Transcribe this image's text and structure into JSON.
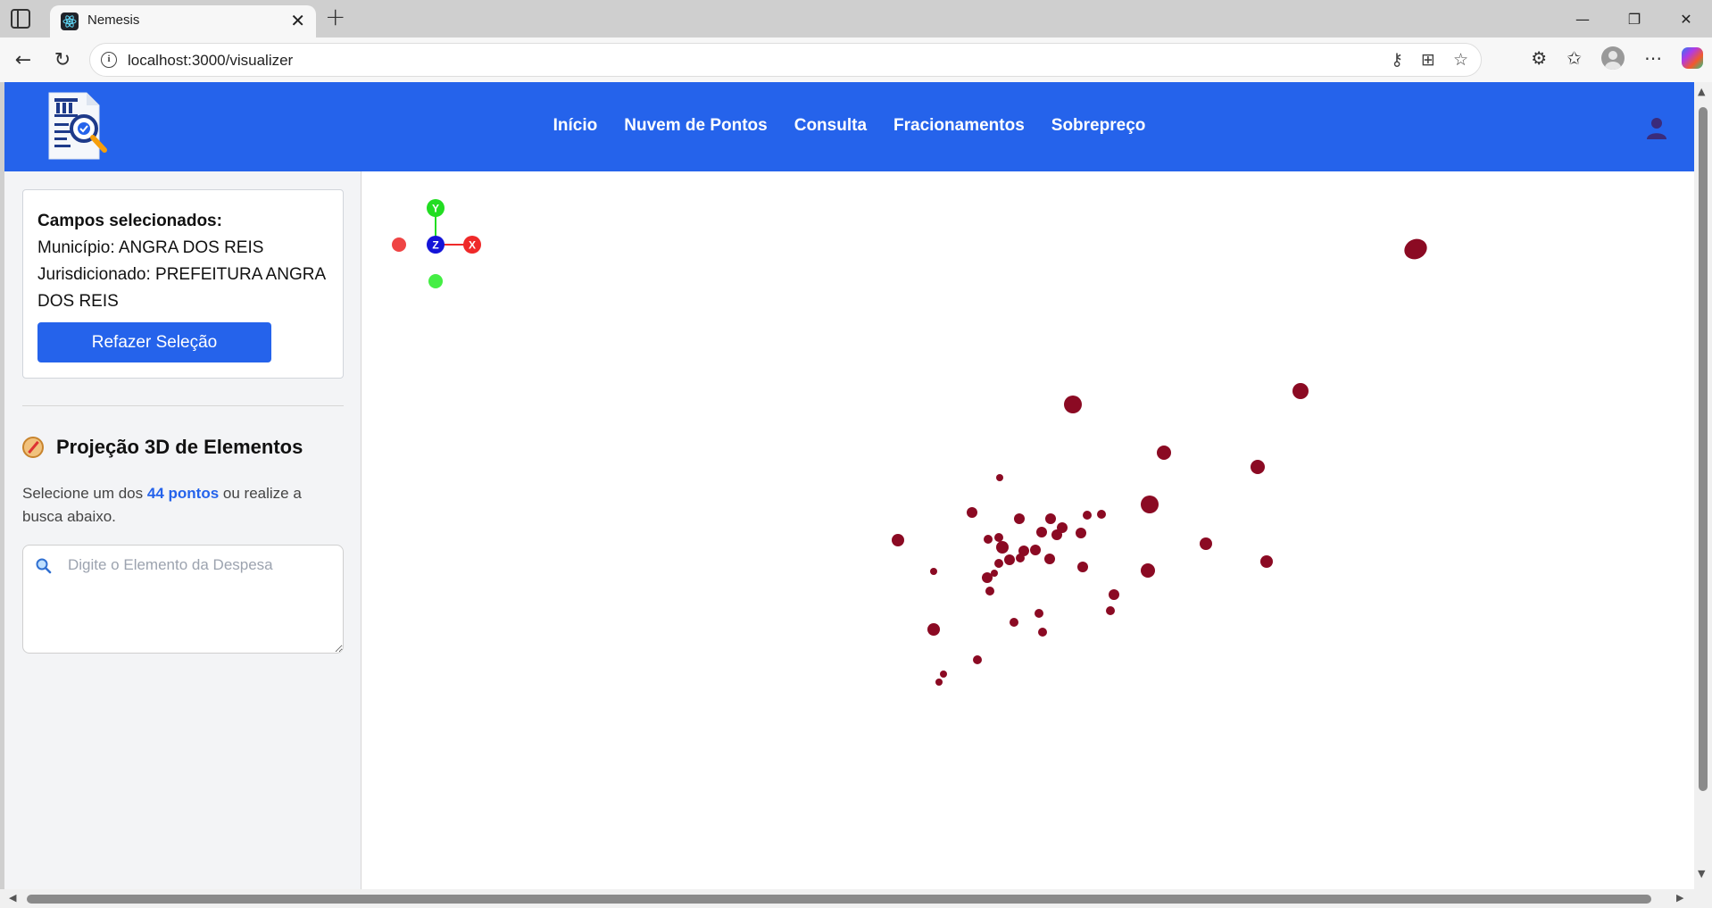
{
  "browser": {
    "tab_title": "Nemesis",
    "url": "localhost:3000/visualizer",
    "icons": [
      "sidebar-toggle-icon",
      "react-icon",
      "close-icon",
      "plus-icon",
      "back-icon",
      "reload-icon",
      "info-icon",
      "key-icon",
      "app-icon",
      "star-icon",
      "extensions-icon",
      "favorites-icon",
      "profile-icon",
      "more-icon",
      "copilot-icon"
    ]
  },
  "header": {
    "nav": [
      "Início",
      "Nuvem de Pontos",
      "Consulta",
      "Fracionamentos",
      "Sobrepreço"
    ],
    "accent": "#2563eb"
  },
  "sidebar": {
    "selection": {
      "heading": "Campos selecionados:",
      "municipio": "Município: ANGRA DOS REIS",
      "jurisdicionado": "Jurisdicionado: PREFEITURA ANGRA DOS REIS",
      "redo_button": "Refazer Seleção"
    },
    "projection": {
      "title": "Projeção 3D de Elementos",
      "hint_prefix": "Selecione um dos ",
      "points_link": "44 pontos",
      "hint_suffix": " ou realize a busca abaixo.",
      "search_placeholder": "Digite o Elemento da Despesa",
      "search_value": ""
    }
  },
  "gizmo": {
    "axes": [
      "X",
      "Y",
      "Z"
    ],
    "colors": {
      "x": "#ef2929",
      "y": "#22dd22",
      "z": "#1414d8",
      "point_color": "#8b0a23"
    }
  }
}
